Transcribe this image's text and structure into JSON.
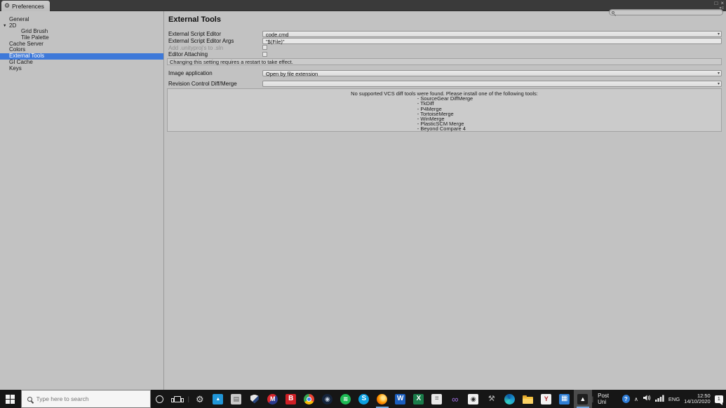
{
  "colors": {
    "selection_blue": "#3e79d9",
    "window_bg": "#c2c2c2",
    "taskbar_bg": "#161616",
    "titlebar_bg": "#3a3a3a"
  },
  "icons": {
    "tab_gear": "⚙",
    "expander": "▼",
    "dropdown_arrow": "▾"
  },
  "window": {
    "tab_label": "Preferences",
    "controls": {
      "maximize": "□",
      "close": "×",
      "menu": "▾≡"
    },
    "sidebar": [
      {
        "label": "General",
        "indent": 0
      },
      {
        "label": "2D",
        "indent": 0,
        "triangle": true
      },
      {
        "label": "Grid Brush",
        "indent": 1
      },
      {
        "label": "Tile Palette",
        "indent": 1
      },
      {
        "label": "Cache Server",
        "indent": 0
      },
      {
        "label": "Colors",
        "indent": 0
      },
      {
        "label": "External Tools",
        "indent": 0,
        "selected": true
      },
      {
        "label": "GI Cache",
        "indent": 0
      },
      {
        "label": "Keys",
        "indent": 0
      }
    ],
    "main": {
      "title": "External Tools",
      "script_editor": {
        "label": "External Script Editor",
        "value": "code.cmd"
      },
      "script_editor_args": {
        "label": "External Script Editor Args",
        "value": "\"$(File)\""
      },
      "add_unityproj": {
        "label": "Add .unityproj's to .sln",
        "checked": false
      },
      "editor_attaching": {
        "label": "Editor Attaching",
        "checked": false
      },
      "restart_note": "Changing this setting requires a restart to take effect.",
      "image_application": {
        "label": "Image application",
        "value": "Open by file extension"
      },
      "revision_control": {
        "label": "Revision Control Diff/Merge",
        "value": ""
      },
      "vcs_notice_heading": "No supported VCS diff tools were found. Please install one of the following tools:",
      "vcs_tools": [
        "- SourceGear DiffMerge",
        "- TkDiff",
        "- P4Merge",
        "- TortoiseMerge",
        "- WinMerge",
        "- PlasticSCM Merge",
        "- Beyond Compare 4"
      ]
    }
  },
  "taskbar": {
    "search_placeholder": "Type here to search",
    "icons": [
      {
        "name": "settings",
        "shape": "plain",
        "glyph": "⚙",
        "fg": "#dcdcdc",
        "size": 13
      },
      {
        "name": "photos",
        "shape": "tile",
        "glyph": "▲",
        "bg": "#2196d8",
        "fg": "#ffffff",
        "size": 7
      },
      {
        "name": "photo-viewer",
        "shape": "tile",
        "glyph": "▤",
        "bg": "#c9c9c9",
        "fg": "#5a5a5a",
        "size": 9
      },
      {
        "name": "security-shield",
        "shape": "shield"
      },
      {
        "name": "mega",
        "shape": "circle",
        "glyph": "M",
        "bg": "linear-gradient(135deg,#d9272e 50%,#2b3a8f 50%)",
        "fg": "#ffffff",
        "size": 9
      },
      {
        "name": "bitdefender",
        "shape": "tile",
        "glyph": "B",
        "bg": "#cf1f25",
        "fg": "#ffffff",
        "size": 10
      },
      {
        "name": "chrome",
        "shape": "chrome"
      },
      {
        "name": "steam",
        "shape": "circle",
        "glyph": "◉",
        "bg": "#15243c",
        "fg": "#c9d4e4",
        "size": 9
      },
      {
        "name": "spotify",
        "shape": "circle",
        "glyph": "≋",
        "bg": "#1db954",
        "fg": "#ffffff",
        "size": 9
      },
      {
        "name": "skype",
        "shape": "circle",
        "glyph": "S",
        "bg": "#0a9fe0",
        "fg": "#ffffff",
        "size": 10
      },
      {
        "name": "firefox",
        "shape": "firefox",
        "open": true
      },
      {
        "name": "word",
        "shape": "tile",
        "glyph": "W",
        "bg": "#1a5dbe",
        "fg": "#ffffff",
        "size": 10
      },
      {
        "name": "excel",
        "shape": "tile",
        "glyph": "X",
        "bg": "#1a7c4a",
        "fg": "#ffffff",
        "size": 10
      },
      {
        "name": "notepad",
        "shape": "tile",
        "glyph": "≡",
        "bg": "#e9e9e9",
        "fg": "#707070",
        "size": 10
      },
      {
        "name": "visual-studio",
        "shape": "plain",
        "glyph": "∞",
        "fg": "#a06fe0",
        "size": 13
      },
      {
        "name": "unity-hub",
        "shape": "tile",
        "glyph": "◉",
        "bg": "#f0f0f0",
        "fg": "#2b2b2b",
        "size": 9
      },
      {
        "name": "modeling-tool",
        "shape": "plain",
        "glyph": "⚒",
        "fg": "#b8b8b8",
        "size": 11
      },
      {
        "name": "edge",
        "shape": "edge"
      },
      {
        "name": "file-explorer",
        "shape": "folder"
      },
      {
        "name": "game-launcher",
        "shape": "tile",
        "glyph": "Y",
        "bg": "#f2f2f2",
        "fg": "#b3282d",
        "size": 9
      },
      {
        "name": "calendar",
        "shape": "tile",
        "glyph": "▦",
        "bg": "#2f7fd6",
        "fg": "#ffffff",
        "size": 10
      },
      {
        "name": "unity-editor",
        "shape": "tile",
        "glyph": "▲",
        "bg": "#1f1f1f",
        "fg": "#ffffff",
        "size": 9,
        "focused": true
      }
    ],
    "tray": {
      "user": "Post Uni",
      "language": "ENG",
      "time": "12:50",
      "date": "14/10/2020",
      "notifications": "1"
    }
  }
}
